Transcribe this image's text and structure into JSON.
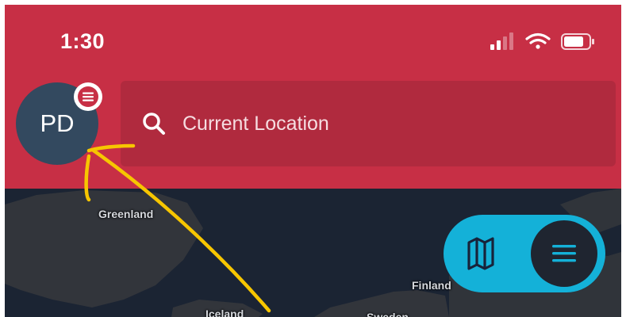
{
  "status_bar": {
    "time": "1:30",
    "icons": [
      "cellular-signal-icon",
      "wifi-icon",
      "battery-icon"
    ]
  },
  "profile": {
    "initials": "PD",
    "badge_icon": "menu-icon"
  },
  "search": {
    "placeholder": "Current Location",
    "icon": "search-icon"
  },
  "map": {
    "labels": [
      "Greenland",
      "Finland",
      "Iceland",
      "Sweden"
    ]
  },
  "view_toggle": {
    "map_icon": "map-icon",
    "list_icon": "list-icon"
  },
  "annotation": {
    "icon": "arrow-annotation-icon"
  },
  "colors": {
    "header": "#c72f45",
    "search_bg": "#b02a3e",
    "avatar": "#33495f",
    "map_water": "#1b2433",
    "toggle": "#14b1d8",
    "annotation_arrow": "#f7c600"
  }
}
